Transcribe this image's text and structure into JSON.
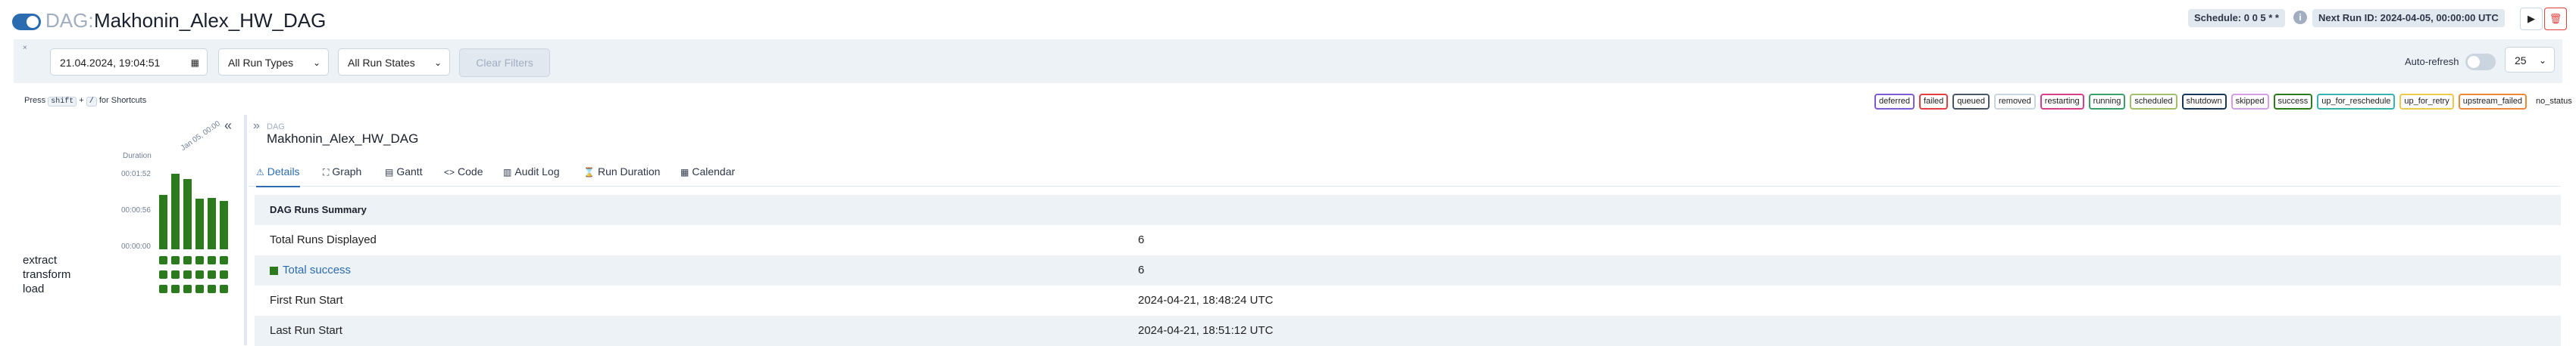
{
  "header": {
    "dag_prefix": "DAG:",
    "dag_title": "Makhonin_Alex_HW_DAG",
    "schedule": "Schedule: 0 0 5 * *",
    "next_run": "Next Run ID: 2024-04-05, 00:00:00 UTC",
    "icons": [
      "info-icon",
      "play-icon",
      "delete-icon"
    ]
  },
  "filters": {
    "date_value": "21.04.2024, 19:04:51",
    "run_types": "All Run Types",
    "run_states": "All Run States",
    "clear": "Clear Filters",
    "autorefresh_label": "Auto-refresh",
    "page_size": "25"
  },
  "shortcuts": {
    "press": "Press",
    "key": "shift",
    "plus": "+",
    "slash": "/",
    "suffix": "for Shortcuts"
  },
  "legend": [
    {
      "label": "deferred",
      "color": "#805ad5"
    },
    {
      "label": "failed",
      "color": "#e53e3e"
    },
    {
      "label": "queued",
      "color": "#4a5568"
    },
    {
      "label": "removed",
      "color": "#cbd5e0"
    },
    {
      "label": "restarting",
      "color": "#d53f8c"
    },
    {
      "label": "running",
      "color": "#38a169"
    },
    {
      "label": "scheduled",
      "color": "#a3bf6c"
    },
    {
      "label": "shutdown",
      "color": "#1a365d"
    },
    {
      "label": "skipped",
      "color": "#d69ee5"
    },
    {
      "label": "success",
      "color": "#2c7a1e"
    },
    {
      "label": "up_for_reschedule",
      "color": "#38b2ac"
    },
    {
      "label": "up_for_retry",
      "color": "#ecc94b"
    },
    {
      "label": "upstream_failed",
      "color": "#ed8936"
    },
    {
      "label": "no_status",
      "color": "#ffffff"
    }
  ],
  "grid": {
    "duration_label": "Duration",
    "ticks": [
      "00:01:52",
      "00:00:56",
      "00:00:00"
    ],
    "run_label": "Jan 05, 00:00",
    "durations": [
      0.72,
      1.0,
      0.93,
      0.67,
      0.68,
      0.64
    ],
    "tasks": [
      "extract",
      "transform",
      "load"
    ]
  },
  "details": {
    "crumb_small": "DAG",
    "crumb_name": "Makhonin_Alex_HW_DAG",
    "tabs": [
      "Details",
      "Graph",
      "Gantt",
      "Code",
      "Audit Log",
      "Run Duration",
      "Calendar"
    ],
    "summary_title": "DAG Runs Summary",
    "rows": [
      {
        "key": "Total Runs Displayed",
        "value": "6"
      },
      {
        "key": "Total success",
        "value": "6"
      },
      {
        "key": "First Run Start",
        "value": "2024-04-21, 18:48:24 UTC"
      },
      {
        "key": "Last Run Start",
        "value": "2024-04-21, 18:51:12 UTC"
      }
    ]
  }
}
